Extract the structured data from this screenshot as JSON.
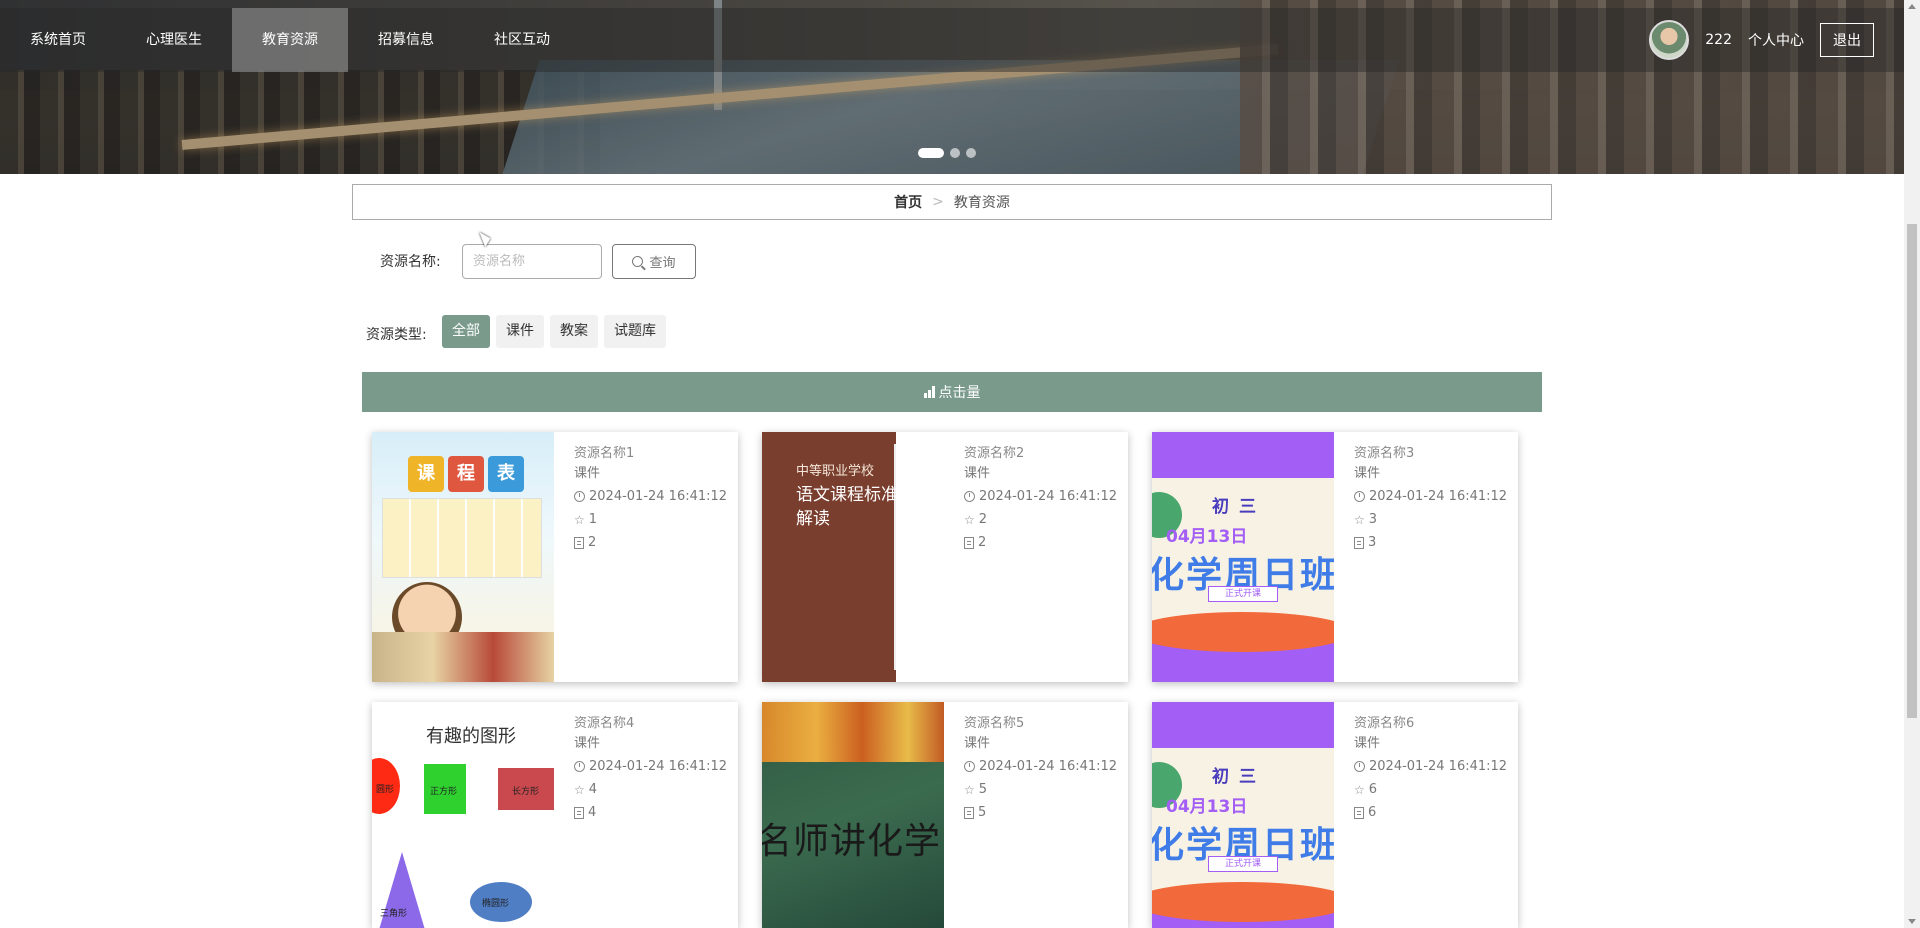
{
  "nav": {
    "items": [
      {
        "label": "系统首页"
      },
      {
        "label": "心理医生"
      },
      {
        "label": "教育资源",
        "active": true
      },
      {
        "label": "招募信息"
      },
      {
        "label": "社区互动"
      }
    ],
    "user": {
      "name": "222",
      "center_label": "个人中心",
      "logout_label": "退出"
    }
  },
  "banner": {
    "slides": 3,
    "active_slide": 1
  },
  "breadcrumb": {
    "home": "首页",
    "separator": ">",
    "current": "教育资源"
  },
  "search": {
    "label": "资源名称:",
    "placeholder": "资源名称",
    "button_label": "查询"
  },
  "filters": {
    "label": "资源类型:",
    "options": [
      "全部",
      "课件",
      "教案",
      "试题库"
    ],
    "selected": "全部"
  },
  "sort": {
    "label": "点击量"
  },
  "cards": [
    {
      "title": "资源名称1",
      "type": "课件",
      "time": "2024-01-24 16:41:12",
      "favorites": "1",
      "views": "2"
    },
    {
      "title": "资源名称2",
      "type": "课件",
      "time": "2024-01-24 16:41:12",
      "favorites": "2",
      "views": "2"
    },
    {
      "title": "资源名称3",
      "type": "课件",
      "time": "2024-01-24 16:41:12",
      "favorites": "3",
      "views": "3"
    },
    {
      "title": "资源名称4",
      "type": "课件",
      "time": "2024-01-24 16:41:12",
      "favorites": "4",
      "views": "4"
    },
    {
      "title": "资源名称5",
      "type": "课件",
      "time": "2024-01-24 16:41:12",
      "favorites": "5",
      "views": "5"
    },
    {
      "title": "资源名称6",
      "type": "课件",
      "time": "2024-01-24 16:41:12",
      "favorites": "6",
      "views": "6"
    }
  ],
  "thumbs": {
    "t1": {
      "chars": [
        "课",
        "程",
        "表"
      ]
    },
    "t2": {
      "line1": "中等职业学校",
      "line2": "语文课程标准",
      "line3": "解读"
    },
    "t3": {
      "line1": "初三",
      "line2": "04月13日",
      "line3": "化学周日班",
      "tag": "正式开课"
    },
    "t4": {
      "heading": "有趣的图形",
      "square": "正方形",
      "rect": "长方形",
      "triangle": "三角形",
      "oval": "椭圆形",
      "circle": "圆形"
    },
    "t5": {
      "chalk": "名师讲化学"
    }
  },
  "colors": {
    "accent": "#7a9a8c",
    "nav_active": "#a0a0a0"
  }
}
